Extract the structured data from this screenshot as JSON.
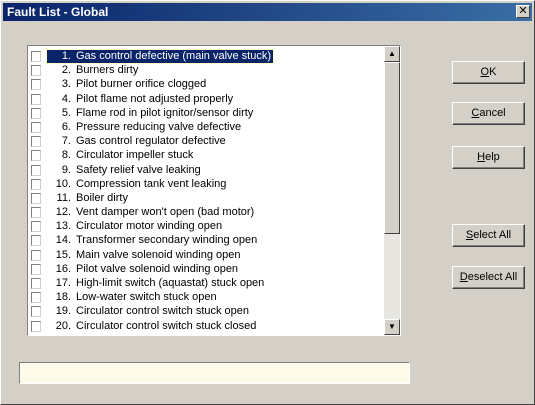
{
  "window": {
    "title": "Fault List - Global",
    "close_glyph": "✕"
  },
  "list": {
    "selected_index": 0,
    "items": [
      {
        "num": "1.",
        "label": "Gas control defective (main valve stuck)"
      },
      {
        "num": "2.",
        "label": "Burners dirty"
      },
      {
        "num": "3.",
        "label": "Pilot burner orifice clogged"
      },
      {
        "num": "4.",
        "label": "Pilot flame not adjusted properly"
      },
      {
        "num": "5.",
        "label": "Flame rod in pilot ignitor/sensor dirty"
      },
      {
        "num": "6.",
        "label": "Pressure reducing valve defective"
      },
      {
        "num": "7.",
        "label": "Gas control regulator defective"
      },
      {
        "num": "8.",
        "label": "Circulator impeller stuck"
      },
      {
        "num": "9.",
        "label": "Safety relief valve leaking"
      },
      {
        "num": "10.",
        "label": "Compression tank vent leaking"
      },
      {
        "num": "11.",
        "label": "Boiler dirty"
      },
      {
        "num": "12.",
        "label": "Vent damper won't open (bad motor)"
      },
      {
        "num": "13.",
        "label": "Circulator motor winding open"
      },
      {
        "num": "14.",
        "label": "Transformer secondary winding open"
      },
      {
        "num": "15.",
        "label": "Main valve solenoid winding open"
      },
      {
        "num": "16.",
        "label": "Pilot valve solenoid winding open"
      },
      {
        "num": "17.",
        "label": "High-limit switch (aquastat) stuck open"
      },
      {
        "num": "18.",
        "label": "Low-water switch stuck open"
      },
      {
        "num": "19.",
        "label": "Circulator control switch stuck open"
      },
      {
        "num": "20.",
        "label": "Circulator control switch stuck closed"
      }
    ]
  },
  "buttons": {
    "ok": {
      "mnemonic": "O",
      "rest": "K"
    },
    "cancel": {
      "mnemonic": "C",
      "rest": "ancel"
    },
    "help": {
      "mnemonic": "H",
      "rest": "elp"
    },
    "select_all": {
      "mnemonic": "S",
      "rest": "elect All"
    },
    "deselect_all": {
      "mnemonic": "D",
      "rest": "eselect All"
    }
  },
  "icons": {
    "scroll_up": "▲",
    "scroll_down": "▼"
  },
  "colors": {
    "face": "#d4d0c8",
    "titlebar_start": "#0a246a",
    "titlebar_end": "#3a6ea5",
    "selection": "#0a246a",
    "status_background": "#fffbea"
  }
}
